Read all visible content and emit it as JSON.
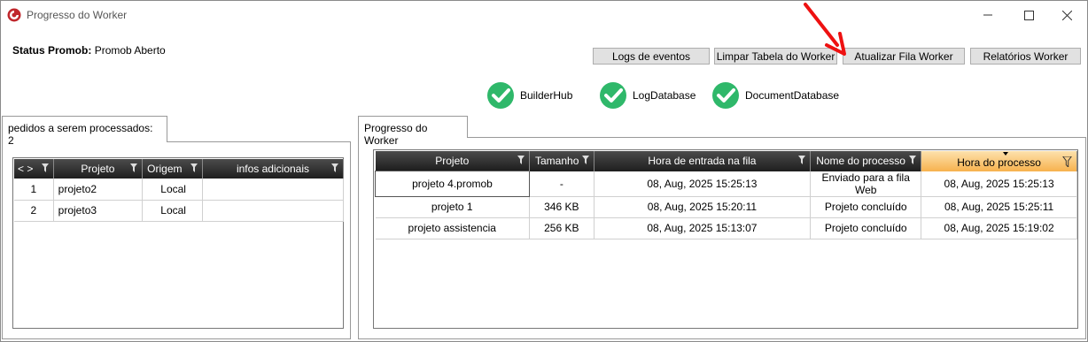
{
  "window": {
    "title": "Progresso do Worker"
  },
  "status": {
    "label": "Status Promob:",
    "value": "Promob Aberto"
  },
  "buttons": {
    "logs": "Logs de eventos",
    "clear": "Limpar Tabela do Worker",
    "update": "Atualizar Fila Worker",
    "reports": "Relatórios Worker"
  },
  "services": [
    {
      "name": "BuilderHub"
    },
    {
      "name": "LogDatabase"
    },
    {
      "name": "DocumentDatabase"
    }
  ],
  "left_tab": {
    "label": "pedidos a serem processados: 2",
    "columns": [
      "< >",
      "Projeto",
      "Origem",
      "infos adicionais"
    ],
    "rows": [
      {
        "index": "1",
        "projeto": "projeto2",
        "origem": "Local",
        "infos": ""
      },
      {
        "index": "2",
        "projeto": "projeto3",
        "origem": "Local",
        "infos": ""
      }
    ]
  },
  "right_tab": {
    "label": "Progresso do Worker",
    "columns": [
      "Projeto",
      "Tamanho",
      "Hora de entrada na fila",
      "Nome do processo",
      "Hora do processo"
    ],
    "rows": [
      {
        "projeto": "projeto 4.promob",
        "tamanho": "-",
        "entrada": "08, Aug, 2025 15:25:13",
        "processo": "Enviado para a fila Web",
        "hora": "08, Aug, 2025 15:25:13"
      },
      {
        "projeto": "projeto 1",
        "tamanho": "346 KB",
        "entrada": "08, Aug, 2025 15:20:11",
        "processo": "Projeto concluído",
        "hora": "08, Aug, 2025 15:25:11"
      },
      {
        "projeto": "projeto assistencia",
        "tamanho": "256 KB",
        "entrada": "08, Aug, 2025 15:13:07",
        "processo": "Projeto concluído",
        "hora": "08, Aug, 2025 15:19:02"
      }
    ]
  },
  "colors": {
    "check_green": "#2fb86a",
    "annotation_arrow": "#ee1111",
    "sorted_header": "#f7b24e"
  }
}
